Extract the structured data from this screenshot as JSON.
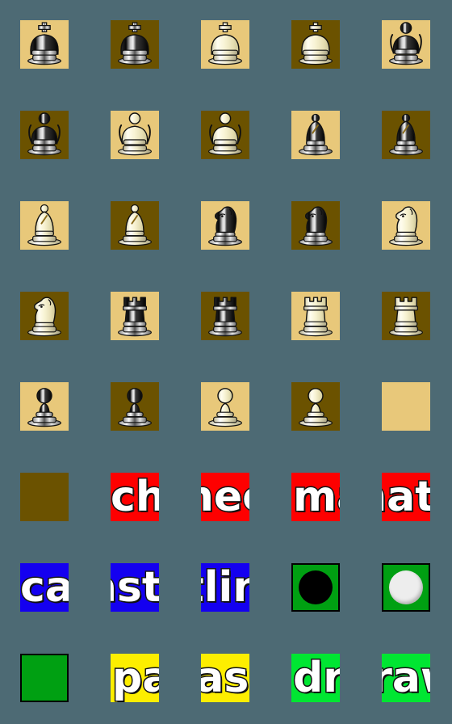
{
  "page": {
    "title": "Chess Emoji Sticker Sheet",
    "background_color": "#4d6a74",
    "columns": 5,
    "rows": 8
  },
  "palette": {
    "board_light": "#e8c87a",
    "board_dark": "#6b5200",
    "check_red": "#fe0000",
    "castling_blue": "#1400f0",
    "pass_yellow": "#fdee00",
    "turn_green": "#00a012",
    "draw_green": "#00e632",
    "piece_black": "#111111",
    "piece_white": "#f5efcf",
    "outline": "#1a1a1a"
  },
  "tiles": [
    {
      "id": 1,
      "kind": "piece",
      "piece": "king",
      "color": "black",
      "square": "light",
      "label": "black-king-on-light-square"
    },
    {
      "id": 2,
      "kind": "piece",
      "piece": "king",
      "color": "black",
      "square": "dark",
      "label": "black-king-on-dark-square"
    },
    {
      "id": 3,
      "kind": "piece",
      "piece": "king",
      "color": "white",
      "square": "light",
      "label": "white-king-on-light-square"
    },
    {
      "id": 4,
      "kind": "piece",
      "piece": "king",
      "color": "white",
      "square": "dark",
      "label": "white-king-on-dark-square"
    },
    {
      "id": 5,
      "kind": "piece",
      "piece": "queen",
      "color": "black",
      "square": "light",
      "label": "black-queen-on-light-square"
    },
    {
      "id": 6,
      "kind": "piece",
      "piece": "queen",
      "color": "black",
      "square": "dark",
      "label": "black-queen-on-dark-square"
    },
    {
      "id": 7,
      "kind": "piece",
      "piece": "queen",
      "color": "white",
      "square": "light",
      "label": "white-queen-on-light-square"
    },
    {
      "id": 8,
      "kind": "piece",
      "piece": "queen",
      "color": "white",
      "square": "dark",
      "label": "white-queen-on-dark-square"
    },
    {
      "id": 9,
      "kind": "piece",
      "piece": "bishop",
      "color": "black",
      "square": "light",
      "label": "black-bishop-on-light-square"
    },
    {
      "id": 10,
      "kind": "piece",
      "piece": "bishop",
      "color": "black",
      "square": "dark",
      "label": "black-bishop-on-dark-square"
    },
    {
      "id": 11,
      "kind": "piece",
      "piece": "bishop",
      "color": "white",
      "square": "light",
      "label": "white-bishop-on-light-square"
    },
    {
      "id": 12,
      "kind": "piece",
      "piece": "bishop",
      "color": "white",
      "square": "dark",
      "label": "white-bishop-on-dark-square"
    },
    {
      "id": 13,
      "kind": "piece",
      "piece": "knight",
      "color": "black",
      "square": "light",
      "label": "black-knight-on-light-square"
    },
    {
      "id": 14,
      "kind": "piece",
      "piece": "knight",
      "color": "black",
      "square": "dark",
      "label": "black-knight-on-dark-square"
    },
    {
      "id": 15,
      "kind": "piece",
      "piece": "knight",
      "color": "white",
      "square": "light",
      "label": "white-knight-on-light-square"
    },
    {
      "id": 16,
      "kind": "piece",
      "piece": "knight",
      "color": "white",
      "square": "dark",
      "label": "white-knight-on-dark-square"
    },
    {
      "id": 17,
      "kind": "piece",
      "piece": "rook",
      "color": "black",
      "square": "light",
      "label": "black-rook-on-light-square"
    },
    {
      "id": 18,
      "kind": "piece",
      "piece": "rook",
      "color": "black",
      "square": "dark",
      "label": "black-rook-on-dark-square"
    },
    {
      "id": 19,
      "kind": "piece",
      "piece": "rook",
      "color": "white",
      "square": "light",
      "label": "white-rook-on-light-square"
    },
    {
      "id": 20,
      "kind": "piece",
      "piece": "rook",
      "color": "white",
      "square": "dark",
      "label": "white-rook-on-dark-square"
    },
    {
      "id": 21,
      "kind": "piece",
      "piece": "pawn",
      "color": "black",
      "square": "light",
      "label": "black-pawn-on-light-square"
    },
    {
      "id": 22,
      "kind": "piece",
      "piece": "pawn",
      "color": "black",
      "square": "dark",
      "label": "black-pawn-on-dark-square"
    },
    {
      "id": 23,
      "kind": "piece",
      "piece": "pawn",
      "color": "white",
      "square": "light",
      "label": "white-pawn-on-light-square"
    },
    {
      "id": 24,
      "kind": "piece",
      "piece": "pawn",
      "color": "white",
      "square": "dark",
      "label": "white-pawn-on-dark-square"
    },
    {
      "id": 25,
      "kind": "blank",
      "square": "light",
      "label": "empty-light-square"
    },
    {
      "id": 26,
      "kind": "blank",
      "square": "dark",
      "label": "empty-dark-square"
    },
    {
      "id": 27,
      "kind": "word",
      "word": "check",
      "bg": "red",
      "text_color": "#ffffff",
      "fragment": "che",
      "offset": 0,
      "label": "check-word-part-1"
    },
    {
      "id": 28,
      "kind": "word",
      "word": "check",
      "bg": "red",
      "text_color": "#ffffff",
      "fragment": "eck",
      "offset": -52,
      "label": "check-word-part-2"
    },
    {
      "id": 29,
      "kind": "word",
      "word": "mate",
      "bg": "red",
      "text_color": "#ffffff",
      "fragment": "ma",
      "offset": 2,
      "label": "mate-word-part-1"
    },
    {
      "id": 30,
      "kind": "word",
      "word": "mate",
      "bg": "red",
      "text_color": "#ffffff",
      "fragment": "ate",
      "offset": -48,
      "label": "mate-word-part-2"
    },
    {
      "id": 31,
      "kind": "word",
      "word": "castling",
      "bg": "blue",
      "text_color": "#ffffff",
      "fragment": "cas",
      "offset": 0,
      "label": "castling-word-part-1"
    },
    {
      "id": 32,
      "kind": "word",
      "word": "castling",
      "bg": "blue",
      "text_color": "#ffffff",
      "fragment": "stli",
      "offset": -58,
      "label": "castling-word-part-2"
    },
    {
      "id": 33,
      "kind": "word",
      "word": "castling",
      "bg": "blue",
      "text_color": "#ffffff",
      "fragment": "ing",
      "offset": -118,
      "label": "castling-word-part-3"
    },
    {
      "id": 34,
      "kind": "disc",
      "disc": "black",
      "bg": "green",
      "bordered": true,
      "label": "black-to-move-marker"
    },
    {
      "id": 35,
      "kind": "disc",
      "disc": "white",
      "bg": "green",
      "bordered": true,
      "label": "white-to-move-marker"
    },
    {
      "id": 36,
      "kind": "blank",
      "bg": "green",
      "bordered": true,
      "label": "empty-green-marker"
    },
    {
      "id": 37,
      "kind": "word",
      "word": "pass",
      "bg": "yellow",
      "text_color": "#ffffff",
      "fragment": "pa",
      "offset": 2,
      "label": "pass-word-part-1"
    },
    {
      "id": 38,
      "kind": "word",
      "word": "pass",
      "bg": "yellow",
      "text_color": "#ffffff",
      "fragment": "ass",
      "offset": -44,
      "label": "pass-word-part-2"
    },
    {
      "id": 39,
      "kind": "word",
      "word": "draw",
      "bg": "brightgreen",
      "text_color": "#ffffff",
      "fragment": "dra",
      "offset": 2,
      "label": "draw-word-part-1"
    },
    {
      "id": 40,
      "kind": "word",
      "word": "draw",
      "bg": "brightgreen",
      "text_color": "#ffffff",
      "fragment": "aw",
      "offset": -50,
      "label": "draw-word-part-2"
    }
  ],
  "words": [
    "check",
    "mate",
    "castling",
    "pass",
    "draw"
  ],
  "pieces": [
    "king",
    "queen",
    "bishop",
    "knight",
    "rook",
    "pawn"
  ]
}
